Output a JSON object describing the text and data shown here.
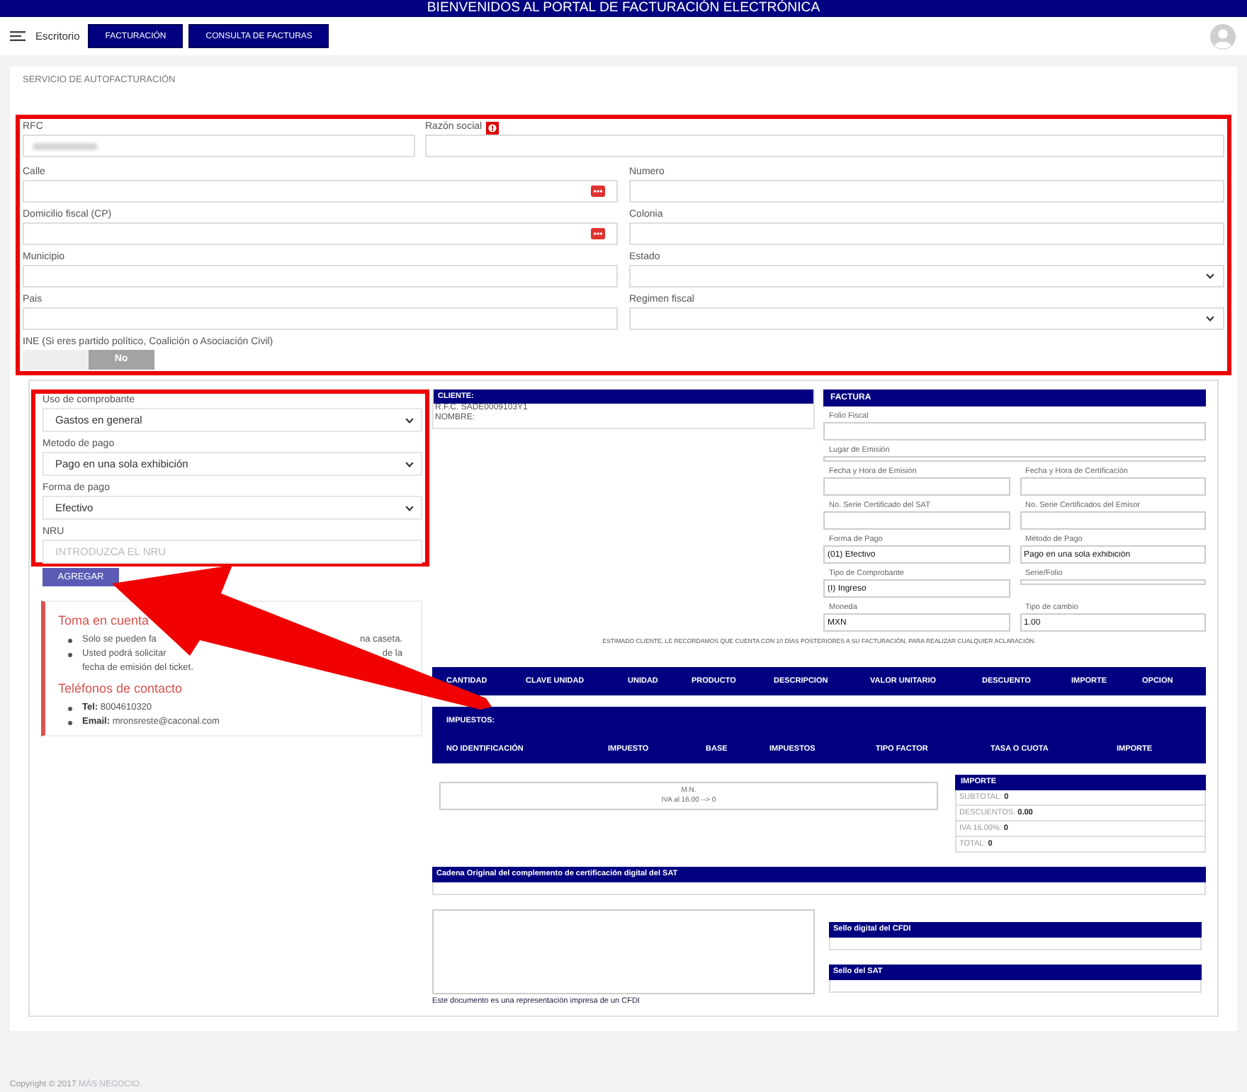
{
  "banner": {
    "title": "BIENVENIDOS AL PORTAL DE FACTURACIÓN ELECTRÓNICA"
  },
  "nav": {
    "home": "Escritorio",
    "buttons": [
      {
        "label": "FACTURACIÓN"
      },
      {
        "label": "CONSULTA DE FACTURAS"
      }
    ]
  },
  "page_title": "SERVICIO DE AUTOFACTURACIÓN",
  "customer_form": {
    "rows": [
      [
        {
          "label": "RFC",
          "kind": "blurred"
        },
        {
          "label": "Razón social",
          "kind": "input",
          "info": true
        }
      ],
      [
        {
          "label": "Calle",
          "kind": "lookup"
        },
        {
          "label": "Numero",
          "kind": "input"
        }
      ],
      [
        {
          "label": "Domicilio fiscal (CP)",
          "kind": "lookup"
        },
        {
          "label": "Colonia",
          "kind": "input"
        }
      ],
      [
        {
          "label": "Municipio",
          "kind": "input"
        },
        {
          "label": "Estado",
          "kind": "select"
        }
      ],
      [
        {
          "label": "Pais",
          "kind": "input"
        },
        {
          "label": "Regimen fiscal",
          "kind": "select"
        }
      ],
      [
        {
          "label": "INE (Si eres partido político, Coalición o Asociación Civil)",
          "kind": "toggle",
          "value": "No",
          "on": false
        }
      ]
    ]
  },
  "invoice_options": {
    "fields": [
      {
        "label": "Uso de comprobante",
        "kind": "select",
        "value": "Gastos en general"
      },
      {
        "label": "Metodo de pago",
        "kind": "select",
        "value": "Pago en una sola exhibición"
      },
      {
        "label": "Forma de pago",
        "kind": "select",
        "value": "Efectivo"
      },
      {
        "label": "NRU",
        "kind": "input",
        "placeholder": "INTRODUZCA EL NRU"
      }
    ],
    "add_button": "AGREGAR"
  },
  "notice_box": {
    "title": "Toma en cuenta",
    "items": [
      {
        "lines": [
          [
            "Solo se pueden fa",
            "na caseta."
          ]
        ]
      },
      {
        "lines": [
          [
            "Usted podrá solicitar",
            "de la"
          ],
          [
            "fecha de emisión del ticket."
          ]
        ]
      }
    ],
    "contact_title": "Teléfonos de contacto",
    "contacts": [
      "**Tel:** 8004610320",
      "**Email:** mronsreste@caconal.com"
    ]
  },
  "client": {
    "title": "CLIENTE:",
    "lines": [
      "R.F.C. SADE0009103Y1",
      "NOMBRE:"
    ]
  },
  "invoice": {
    "title": "FACTURA",
    "rows": [
      [
        {
          "label": "Folio Fiscal",
          "kind": "field"
        }
      ],
      [
        {
          "label": "Lugar de Emisión",
          "kind": "collapsed"
        }
      ],
      [
        {
          "label": "Fecha y Hora de Emisión",
          "kind": "field"
        },
        {
          "label": "Fecha y Hora de Certificación",
          "kind": "field"
        }
      ],
      [
        {
          "label": "No. Serie Certificado del SAT",
          "kind": "field"
        },
        {
          "label": "No. Serie Certificados del Emisor",
          "kind": "field"
        }
      ],
      [
        {
          "label": "Forma de Pago",
          "kind": "field",
          "value": "(01) Efectivo"
        },
        {
          "label": "Método de Pago",
          "kind": "field",
          "value": "Pago en una sola exhibición"
        }
      ],
      [
        {
          "label": "Tipo de Comprobante",
          "kind": "field",
          "value": "(I) Ingreso"
        },
        {
          "label": "Serie/Folio",
          "kind": "collapsed"
        }
      ],
      [
        {
          "label": "Moneda",
          "kind": "field",
          "value": "MXN"
        },
        {
          "label": "Tipo de cambio",
          "kind": "field",
          "value": "1.00"
        }
      ]
    ]
  },
  "reminder": "ESTIMADO CLIENTE, LE RECORDAMOS QUE CUENTA CON 10 DÍAS POSTERIORES A SU FACTURACIÓN, PARA REALIZAR CUALQUIER ACLARACIÓN.",
  "concepts_table": {
    "columns": [
      "CANTIDAD",
      "CLAVE UNIDAD",
      "UNIDAD",
      "PRODUCTO",
      "DESCRIPCION",
      "VALOR UNITARIO",
      "DESCUENTO",
      "IMPORTE",
      "OPCION"
    ]
  },
  "taxes_table": {
    "title": "IMPUESTOS:",
    "columns": [
      "NO IDENTIFICACIÓN",
      "IMPUESTO",
      "BASE",
      "IMPUESTOS",
      "TIPO FACTOR",
      "TASA O CUOTA",
      "IMPORTE"
    ]
  },
  "tax_summary": [
    "M.N.",
    "IVA al 16.00 --> 0"
  ],
  "totals": {
    "title": "IMPORTE",
    "rows": [
      "SUBTOTAL: **0**",
      "DESCUENTOS: **0.00**",
      "IVA 16.00%: **0**",
      "TOTAL: **0**"
    ]
  },
  "original_chain": {
    "title": "Cadena Original del complemento de certificación digital del SAT"
  },
  "seals": [
    {
      "title": "Sello digital del CFDI"
    },
    {
      "title": "Sello del SAT"
    }
  ],
  "disclaimer": "Este documento es una representación impresa de un CFDI",
  "footer": {
    "copyright": "Copyright © 2017",
    "link": "MÁS NEGOCIO."
  }
}
